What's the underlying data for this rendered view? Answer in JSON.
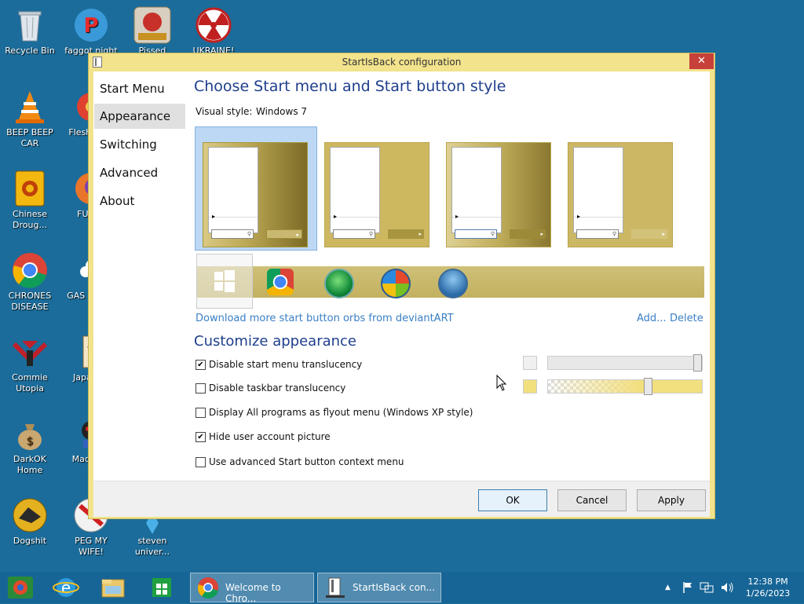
{
  "desktop": {
    "icons": [
      {
        "name": "recycle-bin",
        "label": "Recycle Bin"
      },
      {
        "name": "faggot-night",
        "label": "faggot night"
      },
      {
        "name": "pissed",
        "label": "Pissed"
      },
      {
        "name": "ukraine",
        "label": "UKRAINE!"
      },
      {
        "name": "beep-beep-car",
        "label": "BEEP BEEP CAR"
      },
      {
        "name": "flesh-deli",
        "label": "Flesh DELI"
      },
      {
        "name": "chinese-drougs",
        "label": "Chinese Droug..."
      },
      {
        "name": "furry",
        "label": "FURRY"
      },
      {
        "name": "chrones-disease",
        "label": "CHRONES DISEASE"
      },
      {
        "name": "gas-twe",
        "label": "GAS S TWE"
      },
      {
        "name": "commie-utopia",
        "label": "Commie Utopia"
      },
      {
        "name": "japan-loli",
        "label": "Japa Loli"
      },
      {
        "name": "darkok-home",
        "label": "DarkOK Home"
      },
      {
        "name": "mad-in-s",
        "label": "Mad IN S"
      },
      {
        "name": "dogshit",
        "label": "Dogshit"
      },
      {
        "name": "peg-my-wife",
        "label": "PEG MY WIFE!"
      },
      {
        "name": "steven-univer",
        "label": "steven univer..."
      }
    ]
  },
  "window": {
    "title": "StartIsBack configuration",
    "close_glyph": "✕",
    "nav": [
      "Start Menu",
      "Appearance",
      "Switching",
      "Advanced",
      "About"
    ],
    "selected_nav": "Appearance",
    "heading1": "Choose Start menu and Start button style",
    "visual_style_label": "Visual style:",
    "visual_style_value": "Windows 7",
    "download_link": "Download more start button orbs from deviantART",
    "add_link": "Add...",
    "delete_link": "Delete",
    "heading2": "Customize appearance",
    "options": [
      {
        "label": "Disable start menu translucency",
        "checked": true
      },
      {
        "label": "Disable taskbar translucency",
        "checked": false
      },
      {
        "label": "Display All programs as flyout menu (Windows XP style)",
        "checked": false
      },
      {
        "label": "Hide user account picture",
        "checked": true
      },
      {
        "label": "Use advanced Start button context menu",
        "checked": false
      }
    ],
    "check_glyph": "✔",
    "search_glyph": "⚲",
    "arrow_glyph": "▸",
    "start_menu_color": "#f0f0f0",
    "taskbar_color": "#f2df7e",
    "start_menu_opacity_pct": 100,
    "taskbar_opacity_pct": 65,
    "buttons": {
      "ok": "OK",
      "cancel": "Cancel",
      "apply": "Apply"
    }
  },
  "taskbar": {
    "tasks": [
      {
        "name": "chrome",
        "label": "Welcome to Chro..."
      },
      {
        "name": "startisback",
        "label": "StartIsBack con..."
      }
    ],
    "time": "12:38 PM",
    "date": "1/26/2023",
    "tray_up_glyph": "▲"
  }
}
